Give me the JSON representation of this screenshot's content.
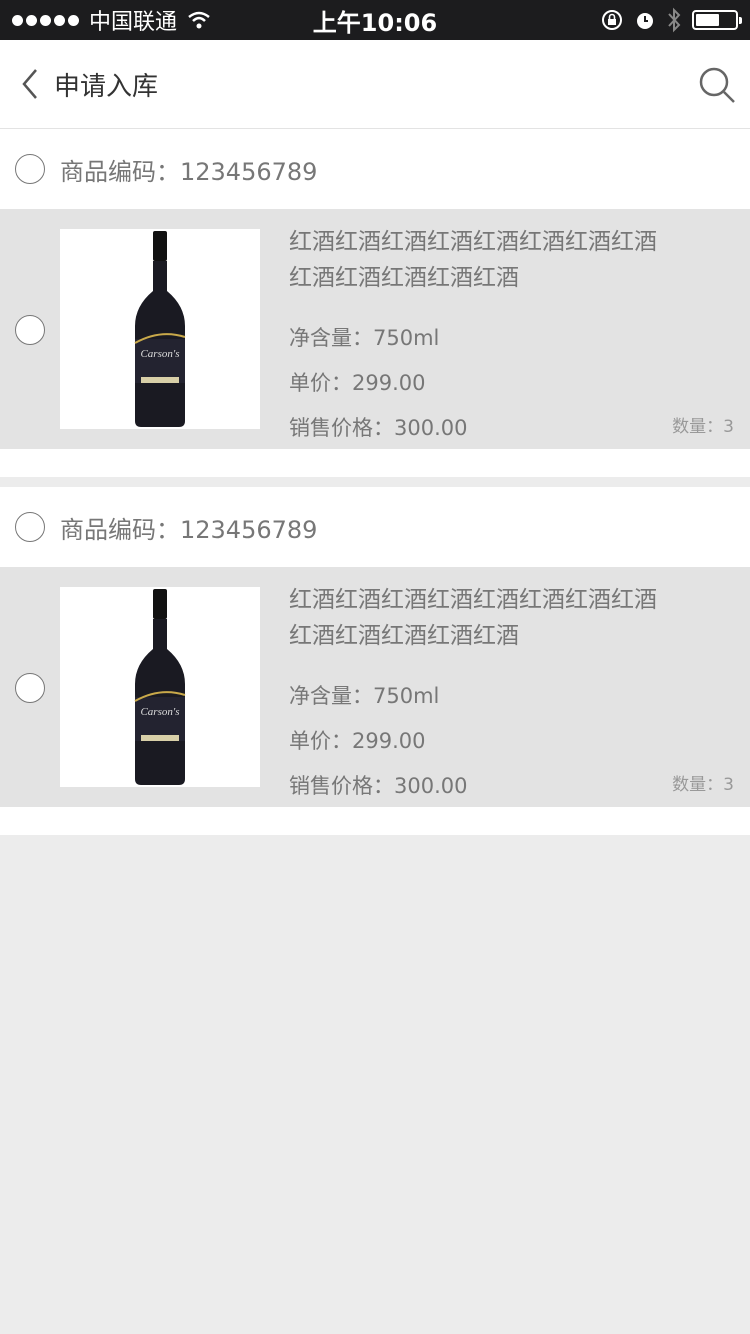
{
  "status_bar": {
    "carrier": "中国联通",
    "time": "上午10:06"
  },
  "nav": {
    "title": "申请入库"
  },
  "groups": [
    {
      "code_label": "商品编码：123456789",
      "item": {
        "name": "红酒红酒红酒红酒红酒红酒红酒红酒红酒红酒红酒红酒红酒",
        "net": "净含量：750ml",
        "unit_price": "单价：299.00",
        "sale_price": "销售价格：300.00",
        "qty": "数量：3"
      }
    },
    {
      "code_label": "商品编码：123456789",
      "item": {
        "name": "红酒红酒红酒红酒红酒红酒红酒红酒红酒红酒红酒红酒红酒",
        "net": "净含量：750ml",
        "unit_price": "单价：299.00",
        "sale_price": "销售价格：300.00",
        "qty": "数量：3"
      }
    }
  ],
  "icons": {
    "back": "chevron-left-icon",
    "search": "search-icon",
    "wifi": "wifi-icon",
    "bluetooth": "bluetooth-icon",
    "alarm": "alarm-icon",
    "lock": "rotation-lock-icon",
    "battery": "battery-icon",
    "product": "wine-bottle-icon"
  }
}
